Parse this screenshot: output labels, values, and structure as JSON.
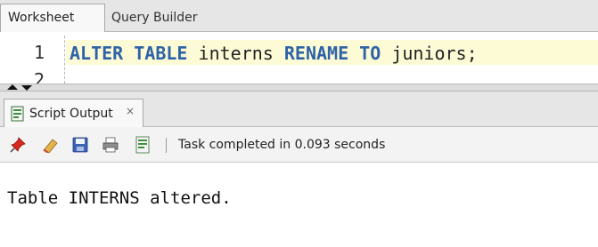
{
  "tabs": {
    "worksheet": "Worksheet",
    "query_builder": "Query Builder"
  },
  "editor": {
    "line_numbers": [
      "1",
      "2"
    ],
    "code": {
      "kw1": "ALTER",
      "kw2": "TABLE",
      "ident1": "interns",
      "kw3": "RENAME",
      "kw4": "TO",
      "ident2": "juniors;"
    }
  },
  "output_panel": {
    "tab_label": "Script Output",
    "close_glyph": "×",
    "toolbar_icons": [
      "pin-icon",
      "eraser-icon",
      "save-icon",
      "print-icon",
      "script-icon"
    ],
    "status": "Task completed in 0.093 seconds",
    "result_text": "Table INTERNS altered."
  },
  "colors": {
    "keyword": "#2e63a6",
    "current_line": "#fcfbd6"
  }
}
